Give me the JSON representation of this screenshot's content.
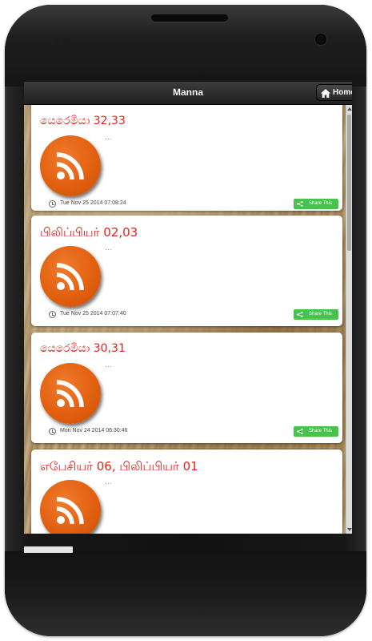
{
  "header": {
    "title": "Manna",
    "home_label": "Home"
  },
  "posts": [
    {
      "title": "යෙරෙමියා 32,33",
      "excerpt": "...",
      "timestamp": "Tue Nov 25 2014 07:08:24",
      "share_label": "Share This"
    },
    {
      "title": "பிலிப்பியர் 02,03",
      "excerpt": "...",
      "timestamp": "Tue Nov 25 2014 07:07:40",
      "share_label": "Share This"
    },
    {
      "title": "යෙරෙමියා 30,31",
      "excerpt": "...",
      "timestamp": "Mon Nov 24 2014 06:30:46",
      "share_label": "Share This"
    },
    {
      "title": "எபேசியர் 06, பிலிப்பியர் 01",
      "excerpt": "..."
    }
  ],
  "colors": {
    "title_red": "#e0231b",
    "rss_orange": "#e05e0e",
    "share_green": "#47c24b"
  },
  "icons": {
    "home": "house-icon",
    "feed": "rss-icon",
    "time": "clock-icon",
    "share": "share-icon"
  }
}
